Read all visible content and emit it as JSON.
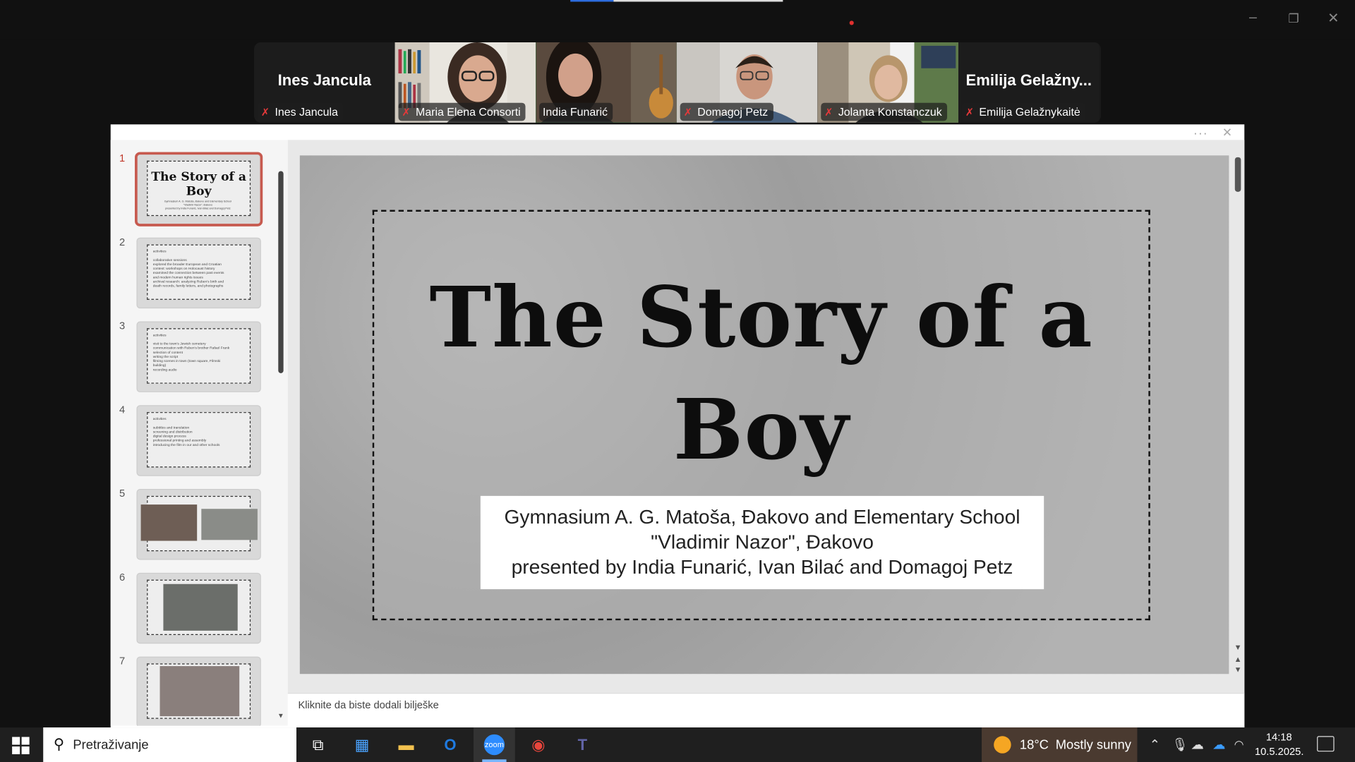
{
  "zoom": {
    "participants": [
      {
        "display_name": "Ines Jancula",
        "label": "Ines Jancula",
        "video": false,
        "speaking": false
      },
      {
        "display_name": "",
        "label": "Maria Elena Consorti",
        "video": true,
        "speaking": false
      },
      {
        "display_name": "",
        "label": "India Funarić",
        "video": true,
        "speaking": true
      },
      {
        "display_name": "",
        "label": "Domagoj Petz",
        "video": true,
        "speaking": false
      },
      {
        "display_name": "",
        "label": "Jolanta Konstanczuk",
        "video": true,
        "speaking": false
      },
      {
        "display_name": "Emilija  Gelažny...",
        "label": "Emilija Gelažnykaitė",
        "video": false,
        "speaking": false
      }
    ],
    "window_controls": {
      "minimize": "–",
      "restore": "❐",
      "close": "✕"
    },
    "speaking_color": "#23d160"
  },
  "presentation": {
    "menu_dots": "···",
    "close": "✕",
    "thumbnails": [
      {
        "number": "1",
        "kind": "title",
        "title": "The Story of a Boy",
        "text": "Gymnasium A. G. Matoša, Đakovo and Elementary School\n\"Vladimir Nazor\", Đakovo\npresented by India Funarić, Ivan Bilać and Domagoj Petz"
      },
      {
        "number": "2",
        "kind": "text",
        "text": "activities\n\ncollaborative sessions\nexplored the broader European and Croatian\ncontext: workshops on Holocaust history\nexamined the connection between past events\nand modern human rights issues\narchival research: analyzing Ruben's birth and\ndeath records, family letters, and photographs"
      },
      {
        "number": "3",
        "kind": "text",
        "text": "activities\n\nvisit to the town's Jewish cemetery\ncommunication with Ruben's brother Rafael Frank\nselection of content\nwriting the script\nfilming scenes in town (town square, Filmski\nbuilding)\nrecording audio"
      },
      {
        "number": "4",
        "kind": "text",
        "text": "activities\n\nsubtitles and translation\nscreening and distribution\ndigital design process\nprofessional printing and assembly\nintroducing the film in our and other schools"
      },
      {
        "number": "5",
        "kind": "photos"
      },
      {
        "number": "6",
        "kind": "photo"
      },
      {
        "number": "7",
        "kind": "photo"
      }
    ],
    "slide": {
      "title_line1": "The Story of a",
      "title_line2": "Boy",
      "subtitle_line1": "Gymnasium A. G. Matoša, Đakovo and Elementary School",
      "subtitle_line2": "\"Vladimir Nazor\", Đakovo",
      "subtitle_line3": "presented by India Funarić, Ivan Bilać and Domagoj Petz"
    },
    "notes_placeholder": "Kliknite da biste dodali bilješke"
  },
  "taskbar": {
    "search_placeholder": "Pretraživanje",
    "apps": [
      {
        "name": "task-view",
        "glyph": "⧉",
        "active": false
      },
      {
        "name": "microsoft-store",
        "glyph": "▦",
        "active": false
      },
      {
        "name": "file-explorer",
        "glyph": "▬",
        "active": false
      },
      {
        "name": "outlook",
        "glyph": "O",
        "active": false
      },
      {
        "name": "zoom",
        "glyph": "zoom",
        "active": true
      },
      {
        "name": "chrome",
        "glyph": "◉",
        "active": false
      },
      {
        "name": "teams",
        "glyph": "T",
        "active": false
      }
    ],
    "weather": {
      "temp": "18°C",
      "condition": "Mostly sunny"
    },
    "clock": {
      "time": "14:18",
      "date": "10.5.2025."
    }
  }
}
